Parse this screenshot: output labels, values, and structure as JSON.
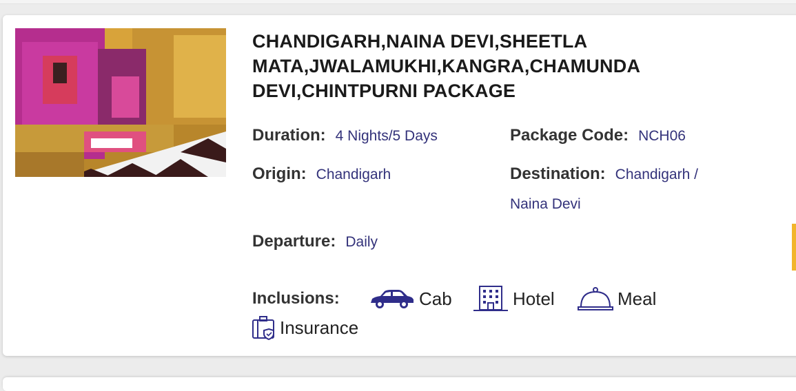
{
  "package": {
    "title": "CHANDIGARH,NAINA DEVI,SHEETLA MATA,JWALAMUKHI,KANGRA,CHAMUNDA DEVI,CHINTPURNI PACKAGE",
    "duration_label": "Duration:",
    "duration_value": "4 Nights/5 Days",
    "code_label": "Package Code:",
    "code_value": "NCH06",
    "origin_label": "Origin:",
    "origin_value": "Chandigarh",
    "destination_label": "Destination:",
    "destination_value": "Chandigarh /",
    "destination_value_cont": "Naina Devi",
    "departure_label": "Departure:",
    "departure_value": "Daily"
  },
  "inclusions": {
    "label": "Inclusions:",
    "items": [
      {
        "label": "Cab",
        "icon": "car-icon"
      },
      {
        "label": "Hotel",
        "icon": "hotel-icon"
      },
      {
        "label": "Meal",
        "icon": "meal-cloche-icon"
      },
      {
        "label": "Insurance",
        "icon": "insurance-icon"
      }
    ]
  },
  "colors": {
    "value_text": "#33327a",
    "label_text": "#333333",
    "icon": "#2f2d8a",
    "accent": "#f2b52b"
  }
}
